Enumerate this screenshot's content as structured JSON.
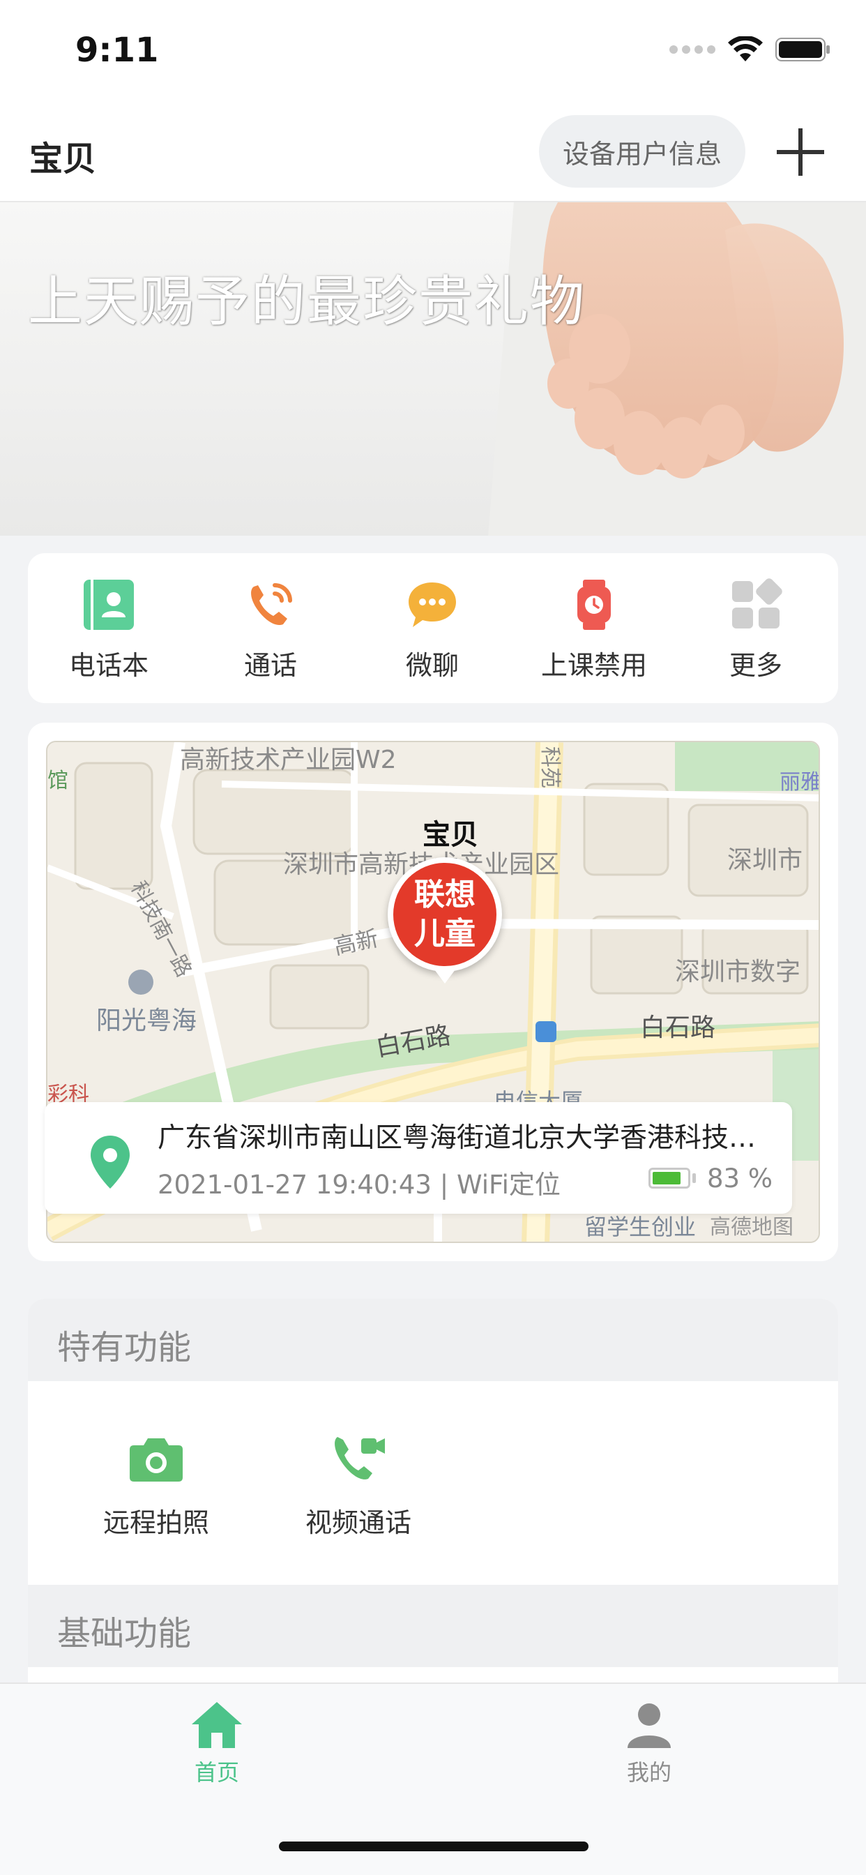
{
  "status_bar": {
    "time": "9:11"
  },
  "nav": {
    "title": "宝贝",
    "info_button": "设备用户信息"
  },
  "banner": {
    "text": "上天赐予的最珍贵礼物",
    "slides": 3,
    "active_slide": 1
  },
  "quick_menu": [
    {
      "label": "电话本",
      "icon": "contacts-icon",
      "color": "#5ccf98"
    },
    {
      "label": "通话",
      "icon": "phone-call-icon",
      "color": "#f0843e"
    },
    {
      "label": "微聊",
      "icon": "chat-bubble-icon",
      "color": "#f4b13a"
    },
    {
      "label": "上课禁用",
      "icon": "watch-icon",
      "color": "#ee5a52"
    },
    {
      "label": "更多",
      "icon": "more-grid-icon",
      "color": "#cfcfcf"
    }
  ],
  "map": {
    "labels": {
      "park_w2": "高新技术产业园W2",
      "park_zone": "深圳市高新技术产业园区",
      "kejinan": "科技南一路",
      "gaoxin": "高新",
      "yangguang": "阳光粤海",
      "baishi_left": "白石路",
      "baishi_right": "白石路",
      "shenzhen_right": "深圳市",
      "shenzhen_digital": "深圳市数字",
      "guan": "馆",
      "liya": "丽雅",
      "kejiao": "科苑",
      "dianxin": "电信大厦",
      "sike": "彩科",
      "liuxuesheng": "留学生创业",
      "gaode": "高德地图"
    },
    "pin": {
      "name": "宝贝",
      "brand_line1": "联想",
      "brand_line2": "儿童"
    },
    "location": {
      "address": "广东省深圳市南山区粤海街道北京大学香港科技大学深圳研修院",
      "meta": "2021-01-27 19:40:43 | WiFi定位",
      "battery_percent": 83,
      "battery_text": "83 %"
    }
  },
  "sections": {
    "special": {
      "title": "特有功能",
      "items": [
        {
          "label": "远程拍照",
          "icon": "camera-icon"
        },
        {
          "label": "视频通话",
          "icon": "video-call-icon"
        }
      ]
    },
    "basic": {
      "title": "基础功能"
    }
  },
  "tabs": [
    {
      "label": "首页",
      "icon": "home-icon",
      "active": true
    },
    {
      "label": "我的",
      "icon": "user-icon",
      "active": false
    }
  ],
  "colors": {
    "brand_green": "#4cc38a",
    "map_pin_red": "#e33a2a",
    "tab_inactive": "#8c8c8c"
  }
}
